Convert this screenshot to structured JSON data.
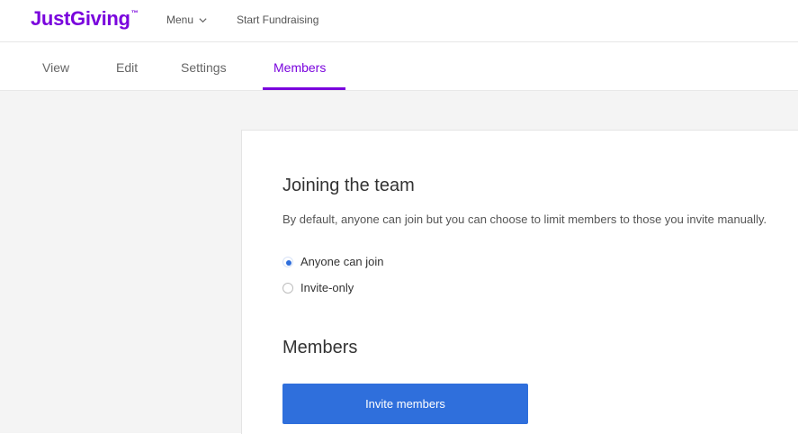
{
  "header": {
    "logo": "JustGiving",
    "logo_tm": "™",
    "menu_label": "Menu",
    "start_fundraising": "Start Fundraising"
  },
  "tabs": [
    {
      "label": "View",
      "active": false
    },
    {
      "label": "Edit",
      "active": false
    },
    {
      "label": "Settings",
      "active": false
    },
    {
      "label": "Members",
      "active": true
    }
  ],
  "joining": {
    "title": "Joining the team",
    "description": "By default, anyone can join but you can choose to limit members to those you invite manually.",
    "options": [
      {
        "label": "Anyone can join",
        "selected": true
      },
      {
        "label": "Invite-only",
        "selected": false
      }
    ]
  },
  "members": {
    "title": "Members",
    "invite_button": "Invite members"
  },
  "colors": {
    "brand": "#7a04dd",
    "primary_button": "#2f6fdc",
    "page_background": "#f4f4f4"
  }
}
